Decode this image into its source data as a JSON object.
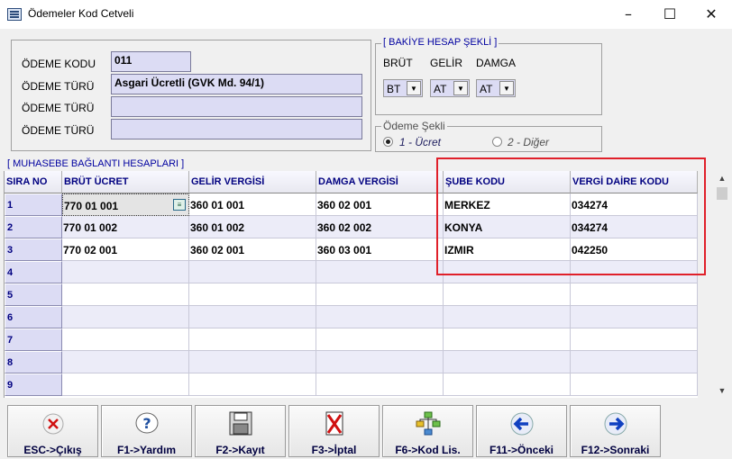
{
  "window": {
    "title": "Ödemeler Kod Cetveli"
  },
  "form": {
    "odeme_kodu_label": "ÖDEME KODU",
    "odeme_kodu_value": "011",
    "odeme_turu_label_1": "ÖDEME TÜRÜ",
    "odeme_turu_value_1": "Asgari Ücretli (GVK Md. 94/1)",
    "odeme_turu_label_2": "ÖDEME TÜRÜ",
    "odeme_turu_value_2": "",
    "odeme_turu_label_3": "ÖDEME TÜRÜ",
    "odeme_turu_value_3": ""
  },
  "bakiye": {
    "title": "[ BAKİYE HESAP ŞEKLİ ]",
    "brut_label": "BRÜT",
    "gelir_label": "GELİR",
    "damga_label": "DAMGA",
    "brut_value": "BT",
    "gelir_value": "AT",
    "damga_value": "AT"
  },
  "odeme_sekli": {
    "title": "Ödeme Şekli",
    "option1": "1 - Ücret",
    "option2": "2 - Diğer",
    "selected": "option1"
  },
  "grid": {
    "title": "[ MUHASEBE BAĞLANTI HESAPLARI ]",
    "headers": {
      "sira": "SIRA NO",
      "brut": "BRÜT ÜCRET",
      "gelir": "GELİR VERGİSİ",
      "damga": "DAMGA VERGİSİ",
      "sube": "ŞUBE KODU",
      "vergi": "VERGİ DAİRE KODU"
    },
    "rows": [
      {
        "no": "1",
        "brut": "770 01 001",
        "gelir": "360 01 001",
        "damga": "360 02 001",
        "sube": "MERKEZ",
        "vergi": "034274"
      },
      {
        "no": "2",
        "brut": "770 01 002",
        "gelir": "360 01 002",
        "damga": "360 02 002",
        "sube": "KONYA",
        "vergi": "034274"
      },
      {
        "no": "3",
        "brut": "770 02 001",
        "gelir": "360 02 001",
        "damga": "360 03 001",
        "sube": "IZMIR",
        "vergi": "042250"
      },
      {
        "no": "4",
        "brut": "",
        "gelir": "",
        "damga": "",
        "sube": "",
        "vergi": ""
      },
      {
        "no": "5",
        "brut": "",
        "gelir": "",
        "damga": "",
        "sube": "",
        "vergi": ""
      },
      {
        "no": "6",
        "brut": "",
        "gelir": "",
        "damga": "",
        "sube": "",
        "vergi": ""
      },
      {
        "no": "7",
        "brut": "",
        "gelir": "",
        "damga": "",
        "sube": "",
        "vergi": ""
      },
      {
        "no": "8",
        "brut": "",
        "gelir": "",
        "damga": "",
        "sube": "",
        "vergi": ""
      },
      {
        "no": "9",
        "brut": "",
        "gelir": "",
        "damga": "",
        "sube": "",
        "vergi": ""
      }
    ]
  },
  "buttons": {
    "esc": "ESC->Çıkış",
    "f1": "F1->Yardım",
    "f2": "F2->Kayıt",
    "f3": "F3->İptal",
    "f6": "F6->Kod Lis.",
    "f11": "F11->Önceki",
    "f12": "F12->Sonraki"
  },
  "colors": {
    "highlight_box": "#e0202a",
    "header_text": "#000080",
    "field_bg": "#dcdcf4"
  }
}
